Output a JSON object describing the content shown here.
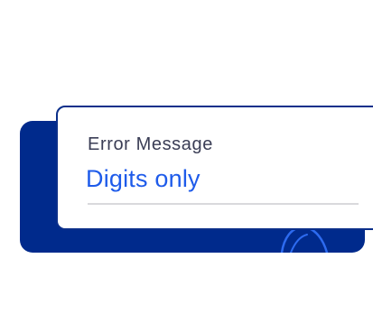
{
  "field": {
    "label": "Error Message",
    "value": "Digits only"
  },
  "colors": {
    "back_card": "#002a8c",
    "front_card_border": "#0b2f8a",
    "label_text": "#3a3d55",
    "value_text": "#1e5bea",
    "underline": "#d9d9dc",
    "decor_line": "#2d6bf0"
  }
}
